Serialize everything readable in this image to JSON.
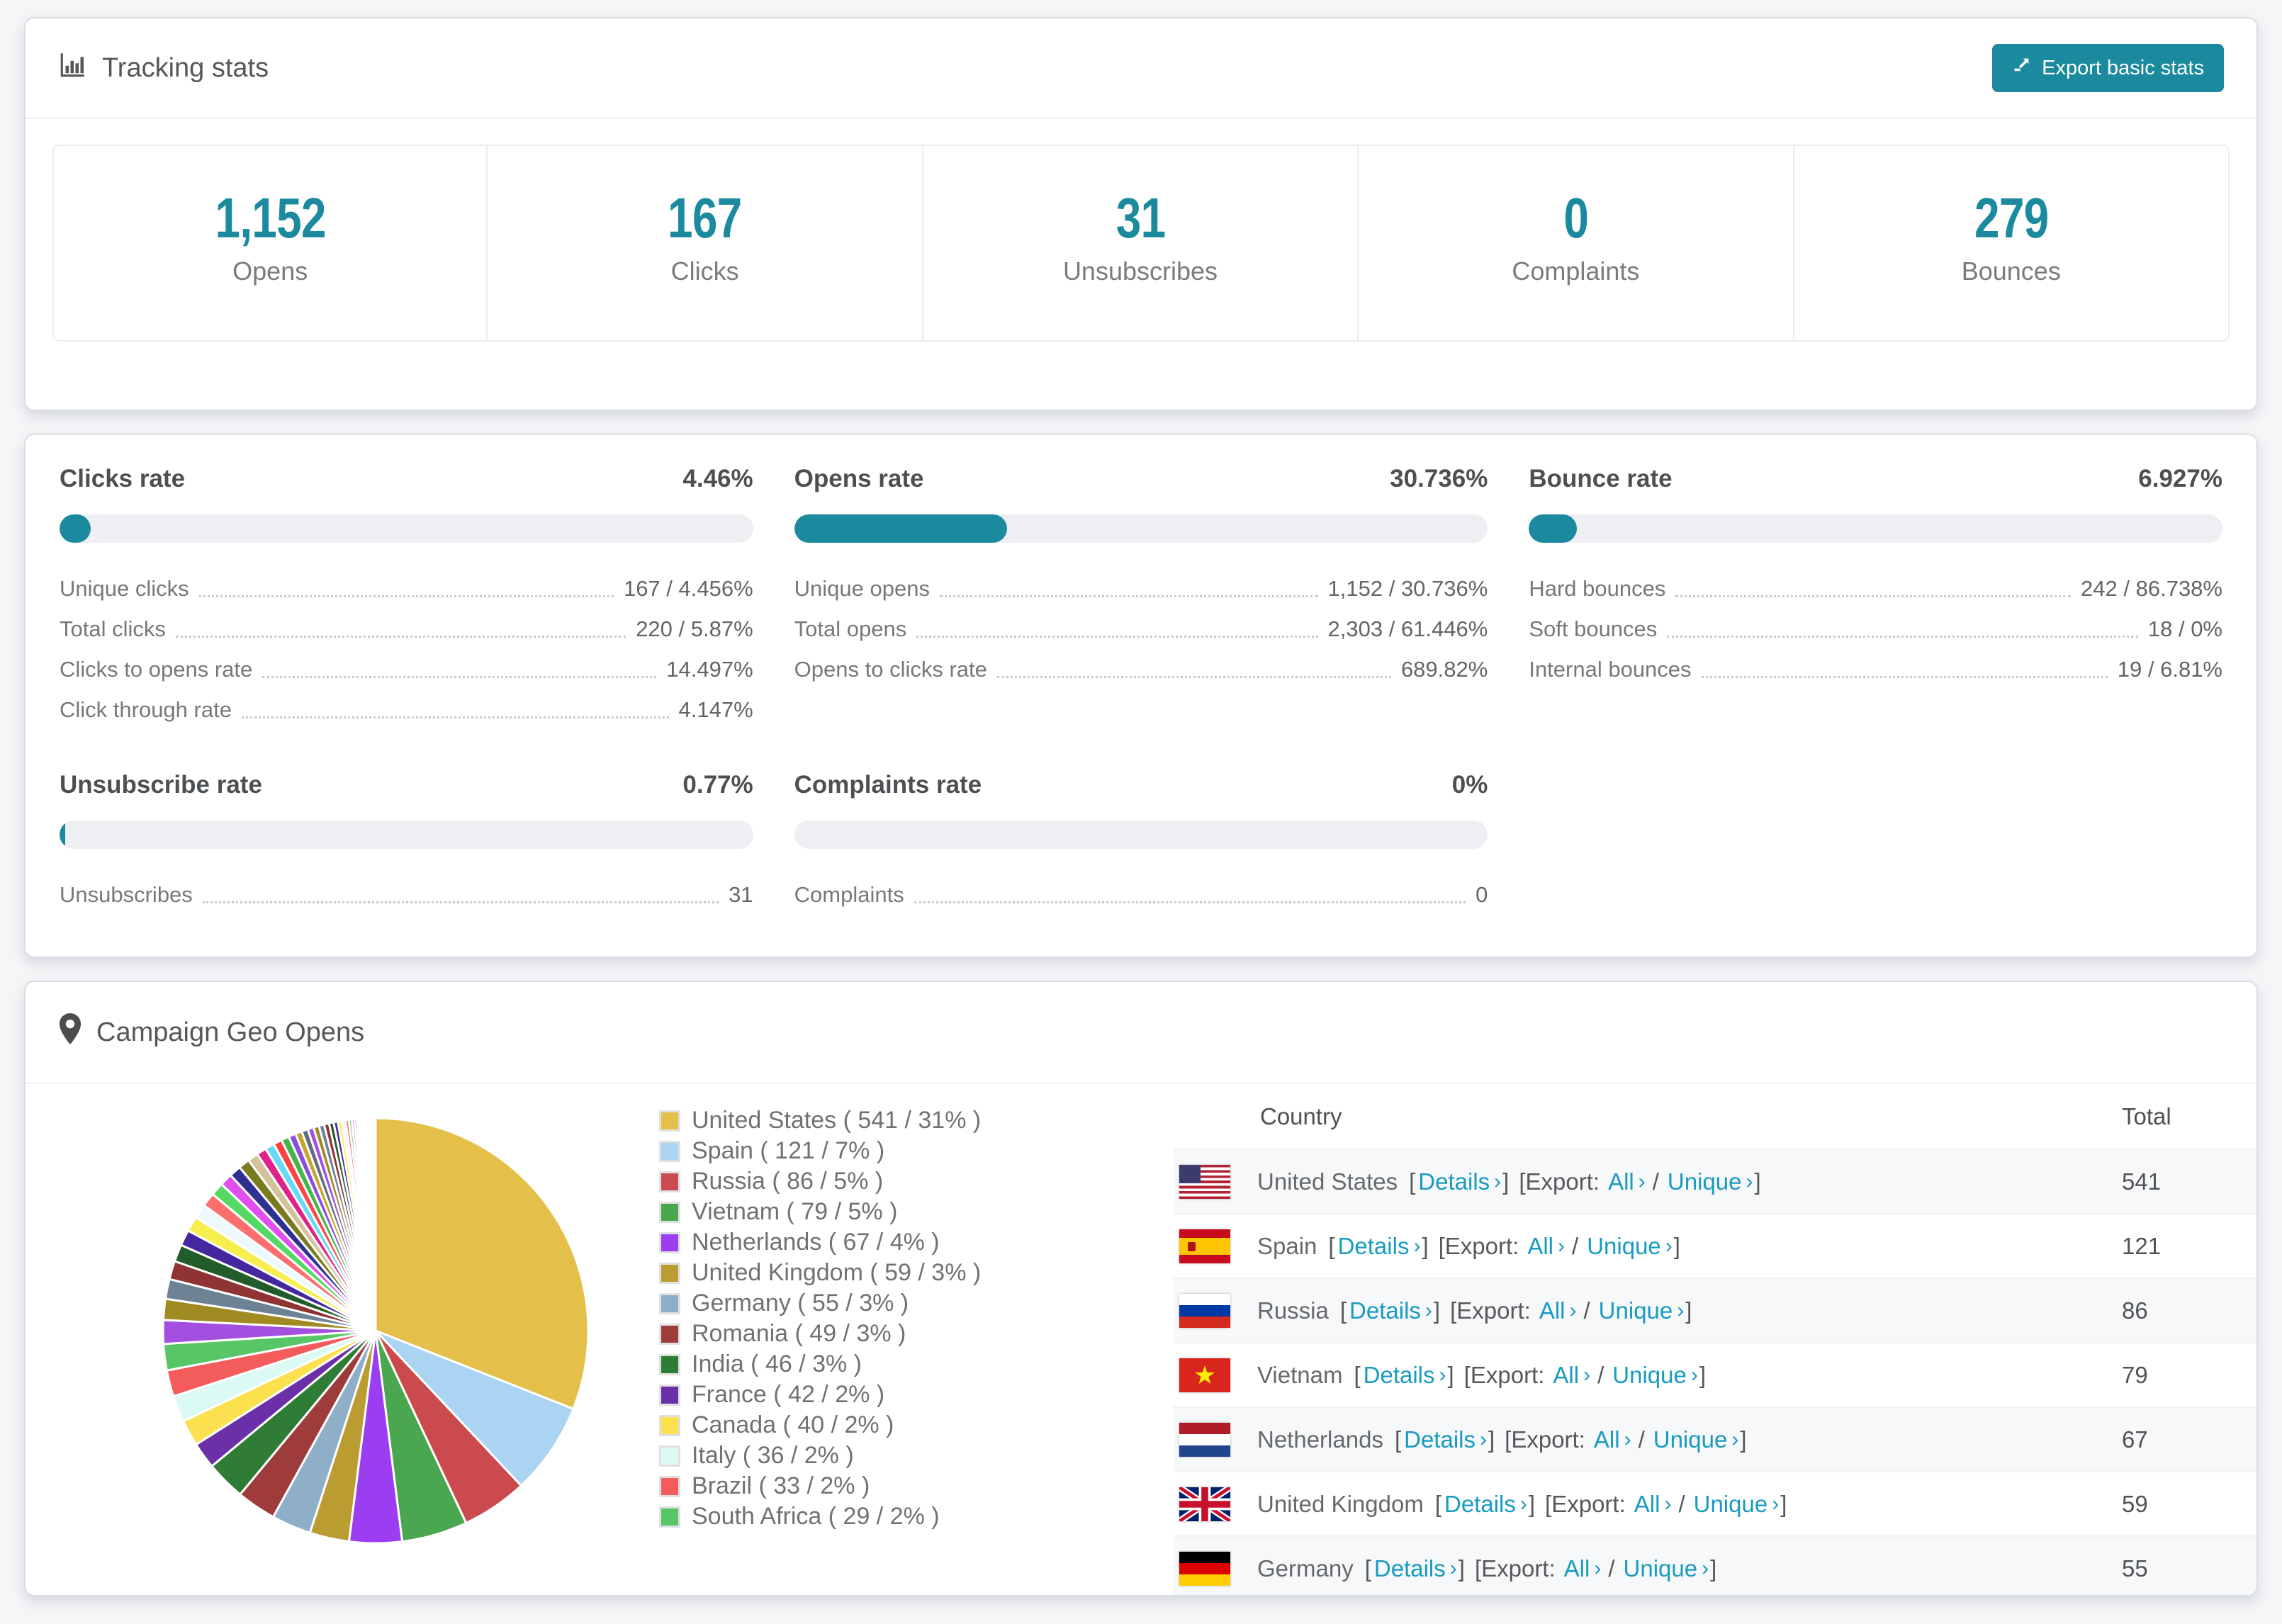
{
  "page": {
    "accent": "#1b8a9e",
    "link_color": "#189bc1",
    "background": "#f6f6f8"
  },
  "tracking": {
    "title": "Tracking stats",
    "export_button": "Export basic stats",
    "stats": [
      {
        "value": "1,152",
        "label": "Opens"
      },
      {
        "value": "167",
        "label": "Clicks"
      },
      {
        "value": "31",
        "label": "Unsubscribes"
      },
      {
        "value": "0",
        "label": "Complaints"
      },
      {
        "value": "279",
        "label": "Bounces"
      }
    ]
  },
  "rates": [
    {
      "title": "Clicks rate",
      "value": "4.46%",
      "bar": 4.46,
      "rows": [
        {
          "label": "Unique clicks",
          "value": "167 / 4.456%"
        },
        {
          "label": "Total clicks",
          "value": "220 / 5.87%"
        },
        {
          "label": "Clicks to opens rate",
          "value": "14.497%"
        },
        {
          "label": "Click through rate",
          "value": "4.147%"
        }
      ]
    },
    {
      "title": "Opens rate",
      "value": "30.736%",
      "bar": 30.736,
      "rows": [
        {
          "label": "Unique opens",
          "value": "1,152 / 30.736%"
        },
        {
          "label": "Total opens",
          "value": "2,303 / 61.446%"
        },
        {
          "label": "Opens to clicks rate",
          "value": "689.82%"
        }
      ]
    },
    {
      "title": "Bounce rate",
      "value": "6.927%",
      "bar": 6.927,
      "rows": [
        {
          "label": "Hard bounces",
          "value": "242 / 86.738%"
        },
        {
          "label": "Soft bounces",
          "value": "18 / 0%"
        },
        {
          "label": "Internal bounces",
          "value": "19 / 6.81%"
        }
      ]
    },
    {
      "title": "Unsubscribe rate",
      "value": "0.77%",
      "bar": 0.77,
      "rows": [
        {
          "label": "Unsubscribes",
          "value": "31"
        }
      ]
    },
    {
      "title": "Complaints rate",
      "value": "0%",
      "bar": 0,
      "rows": [
        {
          "label": "Complaints",
          "value": "0"
        }
      ]
    }
  ],
  "geo": {
    "title": "Campaign Geo Opens",
    "table": {
      "header": {
        "country": "Country",
        "total": "Total"
      },
      "bracket_open": "[",
      "bracket_close": "]",
      "export_prefix": "[Export:",
      "details_label": "Details",
      "all_label": "All",
      "unique_label": "Unique",
      "slash": "/",
      "chevron": "›",
      "rows": [
        {
          "country": "United States",
          "total": "541",
          "flag": "us"
        },
        {
          "country": "Spain",
          "total": "121",
          "flag": "es"
        },
        {
          "country": "Russia",
          "total": "86",
          "flag": "ru"
        },
        {
          "country": "Vietnam",
          "total": "79",
          "flag": "vn"
        },
        {
          "country": "Netherlands",
          "total": "67",
          "flag": "nl"
        },
        {
          "country": "United Kingdom",
          "total": "59",
          "flag": "gb"
        },
        {
          "country": "Germany",
          "total": "55",
          "flag": "de"
        }
      ]
    }
  },
  "chart_data": {
    "type": "pie",
    "title": "Campaign Geo Opens",
    "legend_position": "right",
    "categories": [
      "United States",
      "Spain",
      "Russia",
      "Vietnam",
      "Netherlands",
      "United Kingdom",
      "Germany",
      "Romania",
      "India",
      "France",
      "Canada",
      "Italy",
      "Brazil",
      "South Africa"
    ],
    "counts": [
      541,
      121,
      86,
      79,
      67,
      59,
      55,
      49,
      46,
      42,
      40,
      36,
      33,
      29
    ],
    "percents": [
      31,
      7,
      5,
      5,
      4,
      3,
      3,
      3,
      3,
      2,
      2,
      2,
      2,
      2
    ],
    "colors": [
      "#e4c04a",
      "#abd3f2",
      "#cb4a4e",
      "#4aa64f",
      "#9b3df0",
      "#bb9c31",
      "#8fafc9",
      "#9e3b3b",
      "#2f7c36",
      "#6b2fa8",
      "#fde04e",
      "#dbfaf4",
      "#f45b5b",
      "#56c666"
    ],
    "legend_labels": [
      "United States ( 541 / 31% )",
      "Spain ( 121 / 7% )",
      "Russia ( 86 / 5% )",
      "Vietnam ( 79 / 5% )",
      "Netherlands ( 67 / 4% )",
      "United Kingdom ( 59 / 3% )",
      "Germany ( 55 / 3% )",
      "Romania ( 49 / 3% )",
      "India ( 46 / 3% )",
      "France ( 42 / 2% )",
      "Canada ( 40 / 2% )",
      "Italy ( 36 / 2% )",
      "Brazil ( 33 / 2% )",
      "South Africa ( 29 / 2% )"
    ],
    "others": {
      "percents": [
        1.8,
        1.6,
        1.5,
        1.4,
        1.3,
        1.2,
        1.15,
        1.1,
        1.05,
        1.0,
        0.95,
        0.9,
        0.85,
        0.8,
        0.75,
        0.7,
        0.65,
        0.6,
        0.55,
        0.5,
        0.48,
        0.45,
        0.42,
        0.4,
        0.38,
        0.35,
        0.32,
        0.3,
        0.28,
        0.25,
        0.22,
        0.2,
        0.18,
        0.16,
        0.14,
        0.12,
        0.1,
        0.09,
        0.08,
        0.07,
        0.06,
        0.05
      ],
      "colors": [
        "#a34fe0",
        "#a08a22",
        "#6e8296",
        "#8f3333",
        "#215c2a",
        "#4527a0",
        "#f7ef4e",
        "#eef9ff",
        "#fd6e6e",
        "#56d964",
        "#e14ef0",
        "#2e3192",
        "#7a7a1f",
        "#d4c29a",
        "#e0218a",
        "#66d9f5",
        "#fc4444",
        "#43b54a",
        "#8a4fd8",
        "#c9a227",
        "#5c6e7f"
      ]
    }
  }
}
